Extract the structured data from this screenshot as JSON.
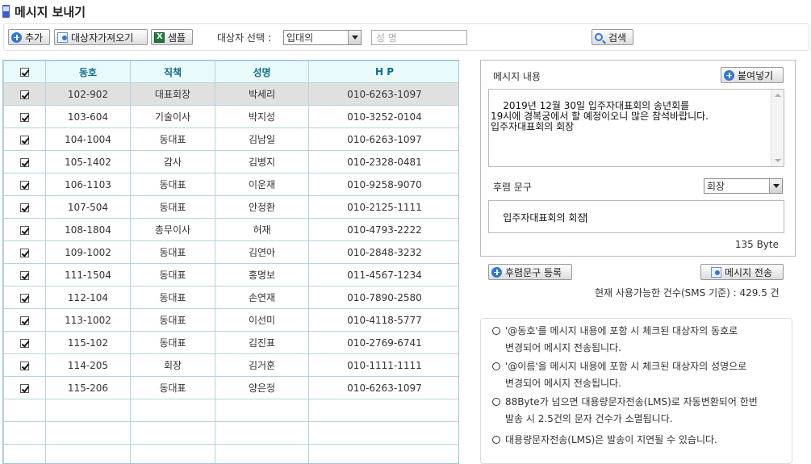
{
  "page": {
    "title": "메시지 보내기"
  },
  "toolbar": {
    "add_label": "추가",
    "import_label": "대상자가져오기",
    "sample_label": "샘플",
    "target_select_label": "대상자 선택 :",
    "target_select_value": "입대의",
    "name_placeholder": "성 명",
    "search_label": "검색"
  },
  "grid": {
    "columns": [
      "동호",
      "직책",
      "성명",
      "H P"
    ],
    "rows": [
      {
        "checked": true,
        "unit": "102-902",
        "position": "대표회장",
        "name": "박세리",
        "phone": "010-6263-1097"
      },
      {
        "checked": true,
        "unit": "103-604",
        "position": "기술이사",
        "name": "박지성",
        "phone": "010-3252-0104"
      },
      {
        "checked": true,
        "unit": "104-1004",
        "position": "동대표",
        "name": "김남일",
        "phone": "010-6263-1097"
      },
      {
        "checked": true,
        "unit": "105-1402",
        "position": "감사",
        "name": "김병지",
        "phone": "010-2328-0481"
      },
      {
        "checked": true,
        "unit": "106-1103",
        "position": "동대표",
        "name": "이운재",
        "phone": "010-9258-9070"
      },
      {
        "checked": true,
        "unit": "107-504",
        "position": "동대표",
        "name": "안정환",
        "phone": "010-2125-1111"
      },
      {
        "checked": true,
        "unit": "108-1804",
        "position": "총무이사",
        "name": "허재",
        "phone": "010-4793-2222"
      },
      {
        "checked": true,
        "unit": "109-1002",
        "position": "동대표",
        "name": "김연아",
        "phone": "010-2848-3232"
      },
      {
        "checked": true,
        "unit": "111-1504",
        "position": "동대표",
        "name": "홍명보",
        "phone": "011-4567-1234"
      },
      {
        "checked": true,
        "unit": "112-104",
        "position": "동대표",
        "name": "손연재",
        "phone": "010-7890-2580"
      },
      {
        "checked": true,
        "unit": "113-1002",
        "position": "동대표",
        "name": "이선미",
        "phone": "010-4118-5777"
      },
      {
        "checked": true,
        "unit": "115-102",
        "position": "동대표",
        "name": "김진표",
        "phone": "010-2769-6741"
      },
      {
        "checked": true,
        "unit": "114-205",
        "position": "회장",
        "name": "김거훈",
        "phone": "010-1111-1111"
      },
      {
        "checked": true,
        "unit": "115-206",
        "position": "동대표",
        "name": "양은정",
        "phone": "010-6263-1097"
      }
    ],
    "empty_rows": 3
  },
  "message": {
    "label": "메시지 내용",
    "paste_label": "붙여넣기",
    "content": "2019년 12월 30일 입주자대표회의 송년회를\n19시에 경복궁에서 할 예정이오니 많은 참석바랍니다.\n입주자대표회의 회장",
    "footer_label": "후렴 문구",
    "footer_select_value": "회장",
    "footer_text": "입주자대표회의 회장",
    "byte_count": "135  Byte"
  },
  "actions": {
    "register_footer_label": "후렴문구 등록",
    "send_label": "메시지 전송",
    "sms_available": "현재 사용가능한 건수(SMS 기준) :   429.5 건"
  },
  "notes": [
    {
      "line1": "'@동호'를 메시지 내용에 포함 시 체크된 대상자의 동호로",
      "line2": "변경되어 메시지 전송됩니다."
    },
    {
      "line1": "'@이름'을 메시지 내용에 포함 시 체크된 대상자의 성명으로",
      "line2": "변경되어 메시지 전송됩니다."
    },
    {
      "line1": "88Byte가 넘으면 대용량문자전송(LMS)로 자동변환되어 한번",
      "line2": "발송 시 2.5건의 문자 건수가 소멸됩니다."
    },
    {
      "line1": "대용량문자전송(LMS)은 발송이 지연될 수 있습니다.",
      "line2": ""
    }
  ]
}
